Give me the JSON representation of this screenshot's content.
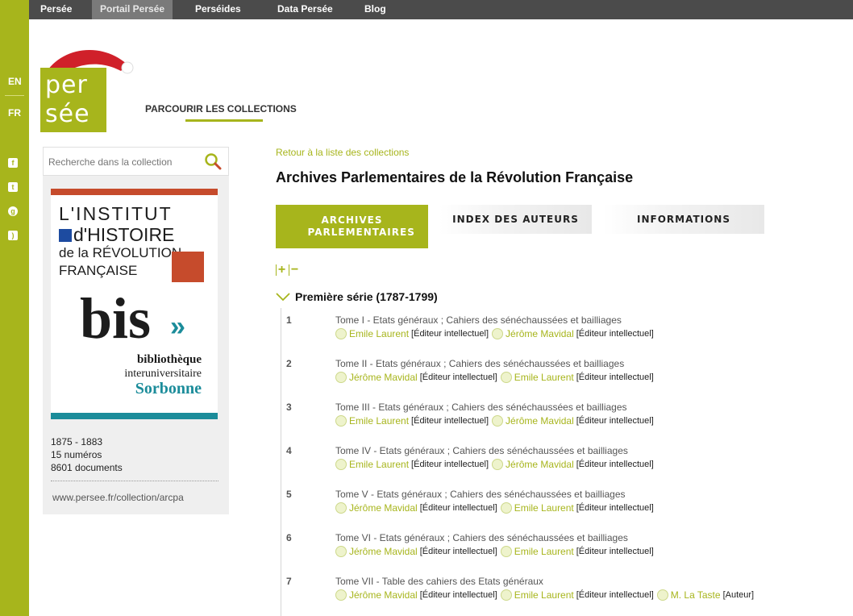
{
  "lang": {
    "en": "EN",
    "fr": "FR"
  },
  "social": [
    "facebook-icon",
    "twitter-icon",
    "google-plus-icon",
    "rss-icon"
  ],
  "topnav": [
    "Persée",
    "Portail Persée",
    "Perséides",
    "Data Persée",
    "Blog"
  ],
  "logo": {
    "line1": "per",
    "line2": "sée"
  },
  "browse_label": "PARCOURIR LES COLLECTIONS",
  "search": {
    "placeholder": "Recherche dans la collection"
  },
  "partner": {
    "l1": "L'INSTITUT",
    "l2": "d'HISTOIRE",
    "l3": "de la RÉVOLUTION",
    "l4": "FRANÇAISE",
    "bis": "bis",
    "bib1": "bibliothèque",
    "bib2": "interuniversitaire",
    "bib3": "Sorbonne"
  },
  "stats": {
    "years": "1875 - 1883",
    "issues": "15 numéros",
    "docs": "8601 documents"
  },
  "collection_url": "www.persee.fr/collection/arcpa",
  "back_link": "Retour à la liste des collections",
  "title": "Archives Parlementaires de la Révolution Française",
  "tabs": [
    "ARCHIVES PARLEMENTAIRES",
    "INDEX DES AUTEURS",
    "INFORMATIONS"
  ],
  "toggle": {
    "expand": "+",
    "collapse": "−"
  },
  "series_label": "Première série (1787-1799)",
  "tomes": [
    {
      "num": "1",
      "title": "Tome I - Etats généraux ; Cahiers des sénéchaussées et bailliages",
      "people": [
        {
          "name": "Emile Laurent",
          "role": "[Éditeur intellectuel]"
        },
        {
          "name": "Jérôme Mavidal",
          "role": "[Éditeur intellectuel]"
        }
      ]
    },
    {
      "num": "2",
      "title": "Tome II - Etats généraux ; Cahiers des sénéchaussées et bailliages",
      "people": [
        {
          "name": "Jérôme Mavidal",
          "role": "[Éditeur intellectuel]"
        },
        {
          "name": "Emile Laurent",
          "role": "[Éditeur intellectuel]"
        }
      ]
    },
    {
      "num": "3",
      "title": "Tome III - Etats généraux ; Cahiers des sénéchaussées et bailliages",
      "people": [
        {
          "name": "Emile Laurent",
          "role": "[Éditeur intellectuel]"
        },
        {
          "name": "Jérôme Mavidal",
          "role": "[Éditeur intellectuel]"
        }
      ]
    },
    {
      "num": "4",
      "title": "Tome IV - Etats généraux ; Cahiers des sénéchaussées et bailliages",
      "people": [
        {
          "name": "Emile Laurent",
          "role": "[Éditeur intellectuel]"
        },
        {
          "name": "Jérôme Mavidal",
          "role": "[Éditeur intellectuel]"
        }
      ]
    },
    {
      "num": "5",
      "title": "Tome V - Etats généraux ; Cahiers des sénéchaussées et bailliages",
      "people": [
        {
          "name": "Jérôme Mavidal",
          "role": "[Éditeur intellectuel]"
        },
        {
          "name": "Emile Laurent",
          "role": "[Éditeur intellectuel]"
        }
      ]
    },
    {
      "num": "6",
      "title": "Tome VI - Etats généraux ; Cahiers des sénéchaussées et bailliages",
      "people": [
        {
          "name": "Jérôme Mavidal",
          "role": "[Éditeur intellectuel]"
        },
        {
          "name": "Emile Laurent",
          "role": "[Éditeur intellectuel]"
        }
      ]
    },
    {
      "num": "7",
      "title": "Tome VII - Table des cahiers des Etats généraux",
      "people": [
        {
          "name": "Jérôme Mavidal",
          "role": "[Éditeur intellectuel]"
        },
        {
          "name": "Emile Laurent",
          "role": "[Éditeur intellectuel]"
        },
        {
          "name": "M. La Taste",
          "role": "[Auteur]"
        }
      ]
    }
  ],
  "colors": {
    "accent": "#a7b51c",
    "nav_bg": "#4b4b4b",
    "red": "#c64b2c",
    "teal": "#1b8c9a"
  }
}
